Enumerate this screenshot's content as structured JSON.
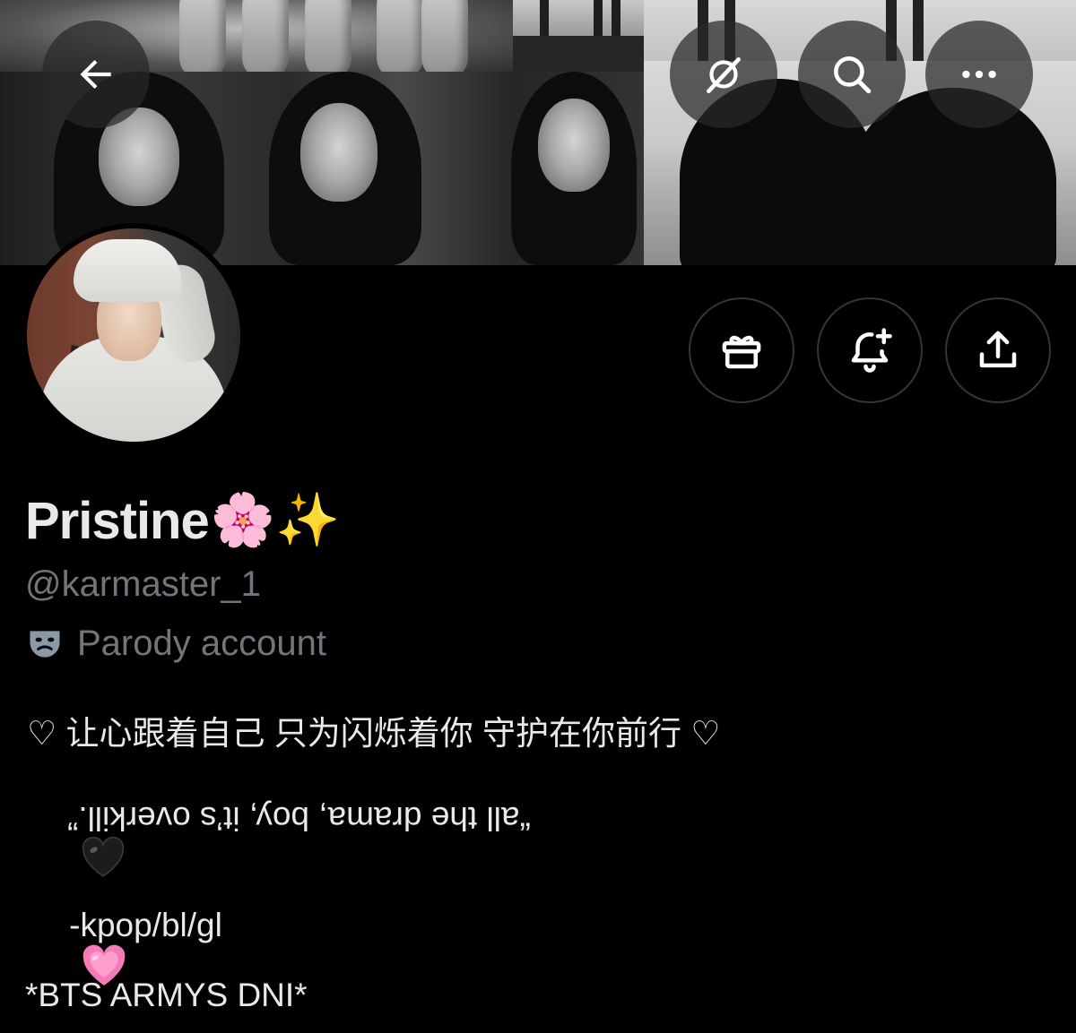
{
  "header": {
    "back_icon": "arrow-left-icon",
    "grok_icon": "grok-icon",
    "search_icon": "search-icon",
    "more_icon": "more-horizontal-icon"
  },
  "actions": {
    "gift_icon": "gift-icon",
    "notify_icon": "bell-plus-icon",
    "share_icon": "share-icon"
  },
  "profile": {
    "name": "Pristine",
    "name_emojis": "🌸✨",
    "handle": "@karmaster_1",
    "label": "Parody account",
    "label_icon": "theater-masks-icon",
    "bio": {
      "line1": "♡ 让心跟着自己 只为闪烁着你 守护在你前行 ♡",
      "line2": "“all the drama, boy, it’s overkill.”",
      "line2_emoji": "🖤",
      "line3": "-kpop/bl/gl",
      "line3_emoji": "💗",
      "line4": "*BTS ARMYS DNI*"
    }
  },
  "colors": {
    "background": "#000000",
    "text_primary": "#e7e9ea",
    "text_secondary": "#71767b",
    "button_border": "#333639"
  }
}
